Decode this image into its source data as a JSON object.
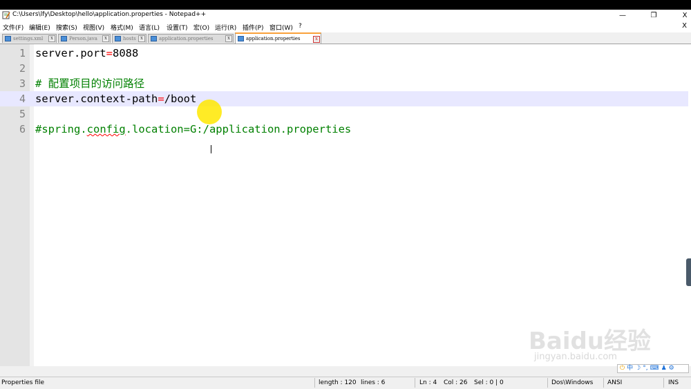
{
  "window": {
    "title": "C:\\Users\\lfy\\Desktop\\hello\\application.properties - Notepad++",
    "minimize": "—",
    "restore": "❐",
    "close": "X"
  },
  "menu": {
    "items": [
      "文件(F)",
      "编辑(E)",
      "搜索(S)",
      "视图(V)",
      "格式(M)",
      "语言(L)",
      "设置(T)",
      "宏(O)",
      "运行(R)",
      "插件(P)",
      "窗口(W)",
      "?"
    ],
    "close": "X"
  },
  "tabs": [
    {
      "label": "settings.xml",
      "active": false
    },
    {
      "label": "Person.java",
      "active": false
    },
    {
      "label": "hosts",
      "active": false
    },
    {
      "label": "application.properties",
      "active": false
    },
    {
      "label": "application.properties",
      "active": true
    }
  ],
  "editor": {
    "lines": [
      {
        "num": "1",
        "parts": [
          {
            "t": "server.port",
            "c": "key"
          },
          {
            "t": "=",
            "c": "op"
          },
          {
            "t": "8088",
            "c": "key"
          }
        ]
      },
      {
        "num": "2",
        "parts": []
      },
      {
        "num": "3",
        "parts": [
          {
            "t": "# 配置项目的访问路径",
            "c": "comment"
          }
        ]
      },
      {
        "num": "4",
        "parts": [
          {
            "t": "server.context-path",
            "c": "key"
          },
          {
            "t": "=",
            "c": "op"
          },
          {
            "t": "/boot",
            "c": "key"
          }
        ]
      },
      {
        "num": "5",
        "parts": []
      },
      {
        "num": "6",
        "parts": [
          {
            "t": "#spring.",
            "c": "comment"
          },
          {
            "t": "config",
            "c": "comment squig"
          },
          {
            "t": ".location=G:/application.properties",
            "c": "comment"
          }
        ]
      }
    ],
    "current_line": 4
  },
  "watermark": {
    "brand": "Baidu经验",
    "url": "jingyan.baidu.com"
  },
  "ime": {
    "items": [
      "中",
      "☽",
      "°,",
      "⌨",
      "♟",
      "⚙"
    ]
  },
  "status": {
    "file_type": "Properties file",
    "length": "length : 120",
    "lines": "lines : 6",
    "ln": "Ln : 4",
    "col": "Col : 26",
    "sel": "Sel : 0 | 0",
    "eol": "Dos\\Windows",
    "encoding": "ANSI",
    "mode": "INS"
  },
  "colors": {
    "operator": "#ff0000",
    "comment": "#008000",
    "current_line": "#e8e8ff",
    "active_tab_accent": "#f9a13a"
  }
}
